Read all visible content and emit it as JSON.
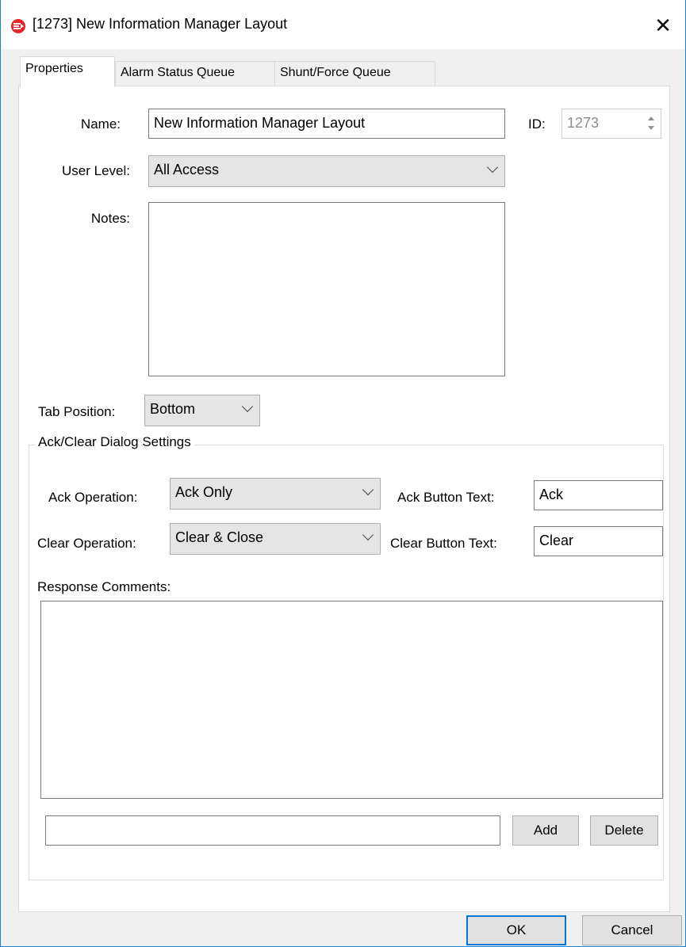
{
  "window": {
    "title": "[1273] New Information Manager Layout",
    "close_glyph": "✕"
  },
  "tabs": [
    {
      "label": "Properties",
      "active": true
    },
    {
      "label": "Alarm Status Queue",
      "active": false
    },
    {
      "label": "Shunt/Force Queue",
      "active": false
    }
  ],
  "properties": {
    "name_label": "Name:",
    "name_value": "New Information Manager Layout",
    "id_label": "ID:",
    "id_value": "1273",
    "user_level_label": "User Level:",
    "user_level_value": "All Access",
    "notes_label": "Notes:",
    "tab_position_label": "Tab Position:",
    "tab_position_value": "Bottom"
  },
  "ack_clear": {
    "group_title": "Ack/Clear Dialog Settings",
    "ack_operation_label": "Ack Operation:",
    "ack_operation_value": "Ack Only",
    "ack_button_text_label": "Ack Button Text:",
    "ack_button_text_value": "Ack",
    "clear_operation_label": "Clear Operation:",
    "clear_operation_value": "Clear & Close",
    "clear_button_text_label": "Clear Button Text:",
    "clear_button_text_value": "Clear",
    "response_comments_label": "Response Comments:",
    "add_label": "Add",
    "delete_label": "Delete"
  },
  "footer": {
    "ok_label": "OK",
    "cancel_label": "Cancel"
  },
  "colors": {
    "accent": "#0078d7",
    "app_icon": "#e8262a",
    "window_border": "#1883d7"
  }
}
